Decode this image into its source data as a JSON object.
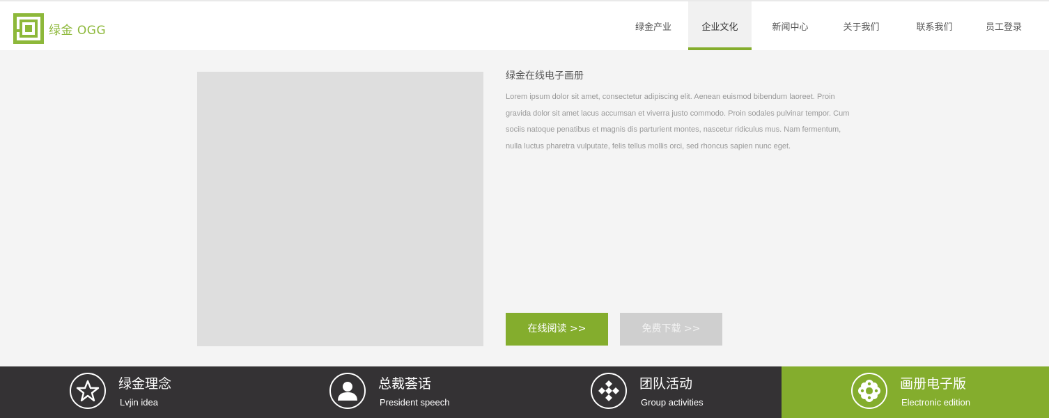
{
  "brand": {
    "text": "绿金 OGG",
    "color": "#8db83a"
  },
  "nav": {
    "items": [
      {
        "label": "绿金产业",
        "active": false
      },
      {
        "label": "企业文化",
        "active": true
      },
      {
        "label": "新闻中心",
        "active": false
      },
      {
        "label": "关于我们",
        "active": false
      },
      {
        "label": "联系我们",
        "active": false
      },
      {
        "label": "员工登录",
        "active": false
      }
    ]
  },
  "main": {
    "title": "绿金在线电子画册",
    "description": "Lorem ipsum dolor sit amet, consectetur adipiscing elit. Aenean euismod bibendum laoreet. Proin gravida dolor sit amet lacus accumsan et viverra justo commodo. Proin sodales pulvinar tempor. Cum sociis natoque penatibus et magnis dis parturient montes, nascetur ridiculus mus. Nam fermentum, nulla luctus pharetra vulputate, felis tellus mollis orci, sed rhoncus sapien nunc eget.",
    "read_button": "在线阅读 >>",
    "download_button": "免费下载 >>"
  },
  "features": [
    {
      "title": "绿金理念",
      "subtitle": "Lvjin idea",
      "icon": "star-icon",
      "active": false
    },
    {
      "title": "总裁荟话",
      "subtitle": "President speech",
      "icon": "person-icon",
      "active": false
    },
    {
      "title": "团队活动",
      "subtitle": "Group activities",
      "icon": "diamond-pattern-icon",
      "active": false
    },
    {
      "title": "画册电子版",
      "subtitle": "Electronic edition",
      "icon": "flower-icon",
      "active": true
    }
  ],
  "colors": {
    "accent": "#84ad2d",
    "footer": "#343234",
    "placeholder": "#dedede"
  }
}
